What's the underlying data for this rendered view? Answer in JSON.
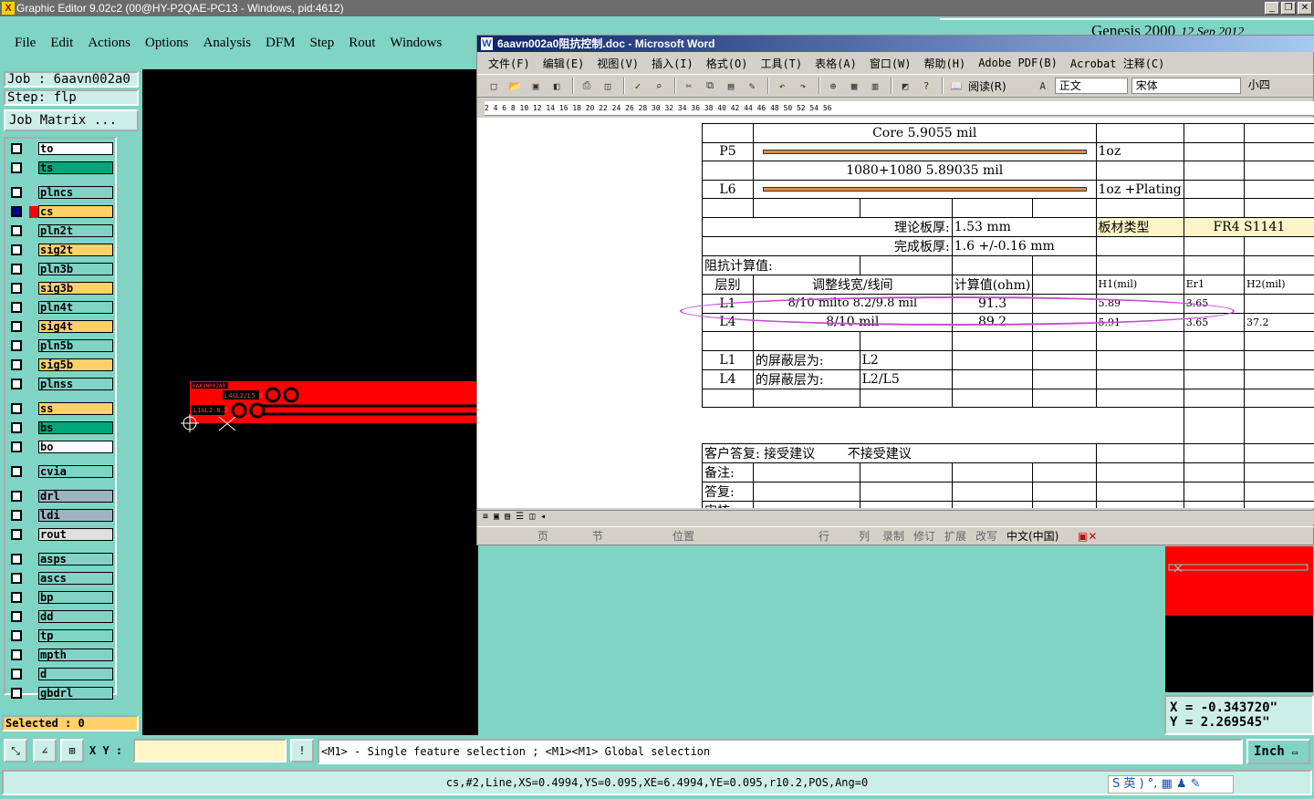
{
  "app": {
    "title": "Graphic Editor 9.02c2 (00@HY-P2QAE-PC13 - Windows, pid:4612)",
    "menu": [
      "File",
      "Edit",
      "Actions",
      "Options",
      "Analysis",
      "DFM",
      "Step",
      "Rout",
      "Windows"
    ],
    "genesis_banner": "Genesis 2000",
    "genesis_date": "12 Sep 2012"
  },
  "left_panel": {
    "job": "Job : 6aavn002a0",
    "step": "Step: flp",
    "job_matrix": "Job Matrix ...",
    "selected": "Selected : 0",
    "layers": [
      {
        "name": "to",
        "color": "#ffffff"
      },
      {
        "name": "ts",
        "color": "#00a67a"
      },
      {
        "name": "plncs",
        "color": "#7fd4c4"
      },
      {
        "name": "cs",
        "color": "#ffd166",
        "active": true
      },
      {
        "name": "pln2t",
        "color": "#7fd4c4"
      },
      {
        "name": "sig2t",
        "color": "#ffd166"
      },
      {
        "name": "pln3b",
        "color": "#7fd4c4"
      },
      {
        "name": "sig3b",
        "color": "#ffd166"
      },
      {
        "name": "pln4t",
        "color": "#7fd4c4"
      },
      {
        "name": "sig4t",
        "color": "#ffd166"
      },
      {
        "name": "pln5b",
        "color": "#7fd4c4"
      },
      {
        "name": "sig5b",
        "color": "#ffd166"
      },
      {
        "name": "plnss",
        "color": "#7fd4c4"
      },
      {
        "name": "ss",
        "color": "#ffd166"
      },
      {
        "name": "bs",
        "color": "#00a67a"
      },
      {
        "name": "bo",
        "color": "#ffffff"
      },
      {
        "name": "cvia",
        "color": "#7fd4c4"
      },
      {
        "name": "drl",
        "color": "#9fb4bf"
      },
      {
        "name": "ldi",
        "color": "#9fb4bf"
      },
      {
        "name": "rout",
        "color": "#e0e0e0"
      },
      {
        "name": "asps",
        "color": "#7fd4c4"
      },
      {
        "name": "ascs",
        "color": "#7fd4c4"
      },
      {
        "name": "bp",
        "color": "#7fd4c4"
      },
      {
        "name": "dd",
        "color": "#7fd4c4"
      },
      {
        "name": "tp",
        "color": "#7fd4c4"
      },
      {
        "name": "mpth",
        "color": "#7fd4c4"
      },
      {
        "name": "d",
        "color": "#7fd4c4"
      },
      {
        "name": "gbdrl",
        "color": "#7fd4c4"
      }
    ]
  },
  "canvas": {
    "label1": "6AAVN002A0",
    "label2": "L4&L2/L5 8",
    "label3": "L1&L2 8.2"
  },
  "word": {
    "title": "6aavn002a0阻抗控制.doc - Microsoft Word",
    "menu": [
      "文件(F)",
      "编辑(E)",
      "视图(V)",
      "插入(I)",
      "格式(O)",
      "工具(T)",
      "表格(A)",
      "窗口(W)",
      "帮助(H)",
      "Adobe PDF(B)",
      "Acrobat 注释(C)"
    ],
    "style_value": "正文",
    "font_value": "宋体",
    "size_value": "小四",
    "read_label": "阅读(R)",
    "ruler": "2  4  6  8  10  12  14  16  18  20  22  24  26  28  30  32  34  36  38  40  42  44  46  48  50  52  54  56",
    "status": [
      "页",
      "节",
      "位置",
      "行",
      "列",
      "录制",
      "修订",
      "扩展",
      "改写",
      "中文(中国)"
    ],
    "rows": {
      "core_text": "Core   5.9055 mil",
      "p5": "P5",
      "p5_cu": "1oz",
      "prepreg": "1080+1080   5.89035 mil",
      "l6": "L6",
      "l6_cu": "1oz +Plating",
      "theory_label": "理论板厚:",
      "theory_value": "1.53 mm",
      "material_label": "板材类型",
      "material_value": "FR4 S1141",
      "finish_label": "完成板厚:",
      "finish_value": "1.6 +/-0.16 mm",
      "calc_title": "阻抗计算值:",
      "h_layer": "层别",
      "h_adjust": "调整线宽/线间",
      "h_calc": "计算值(ohm)",
      "h_h1": "H1(mil)",
      "h_er1": "Er1",
      "h_h2": "H2(mil)",
      "l1": "L1",
      "l1_adjust": "8/10 milto 8.2/9.8 mil",
      "l1_calc": "91.3",
      "l1_h1": "5.89",
      "l1_er1": "3.65",
      "l4": "L4",
      "l4_adjust": "8/10 mil",
      "l4_calc": "89.2",
      "l4_h1": "5.91",
      "l4_er1": "3.65",
      "l4_h2": "37.2",
      "shield_l1_a": "L1",
      "shield_l1_b": "的屏蔽层为:",
      "shield_l1_c": "L2",
      "shield_l4_a": "L4",
      "shield_l4_b": "的屏蔽层为:",
      "shield_l4_c": "L2/L5",
      "reply_label": "客户答复:",
      "reply_accept": "接受建议",
      "reply_reject": "不接受建议",
      "remark": "备注:",
      "answer": "答复:",
      "review": "审核"
    }
  },
  "coords": {
    "x": "X = -0.343720\"",
    "y": "Y = 2.269545\""
  },
  "bottom": {
    "xy_label": "X Y :",
    "message": "<M1> - Single feature selection ; <M1><M1> Global selection",
    "unit": "Inch",
    "command": "cs,#2,Line,XS=0.4994,YS=0.095,XE=6.4994,YE=0.095,r10.2,POS,Ang=0",
    "ime": "S 英 ) °, ▦ ♟ ✎"
  }
}
